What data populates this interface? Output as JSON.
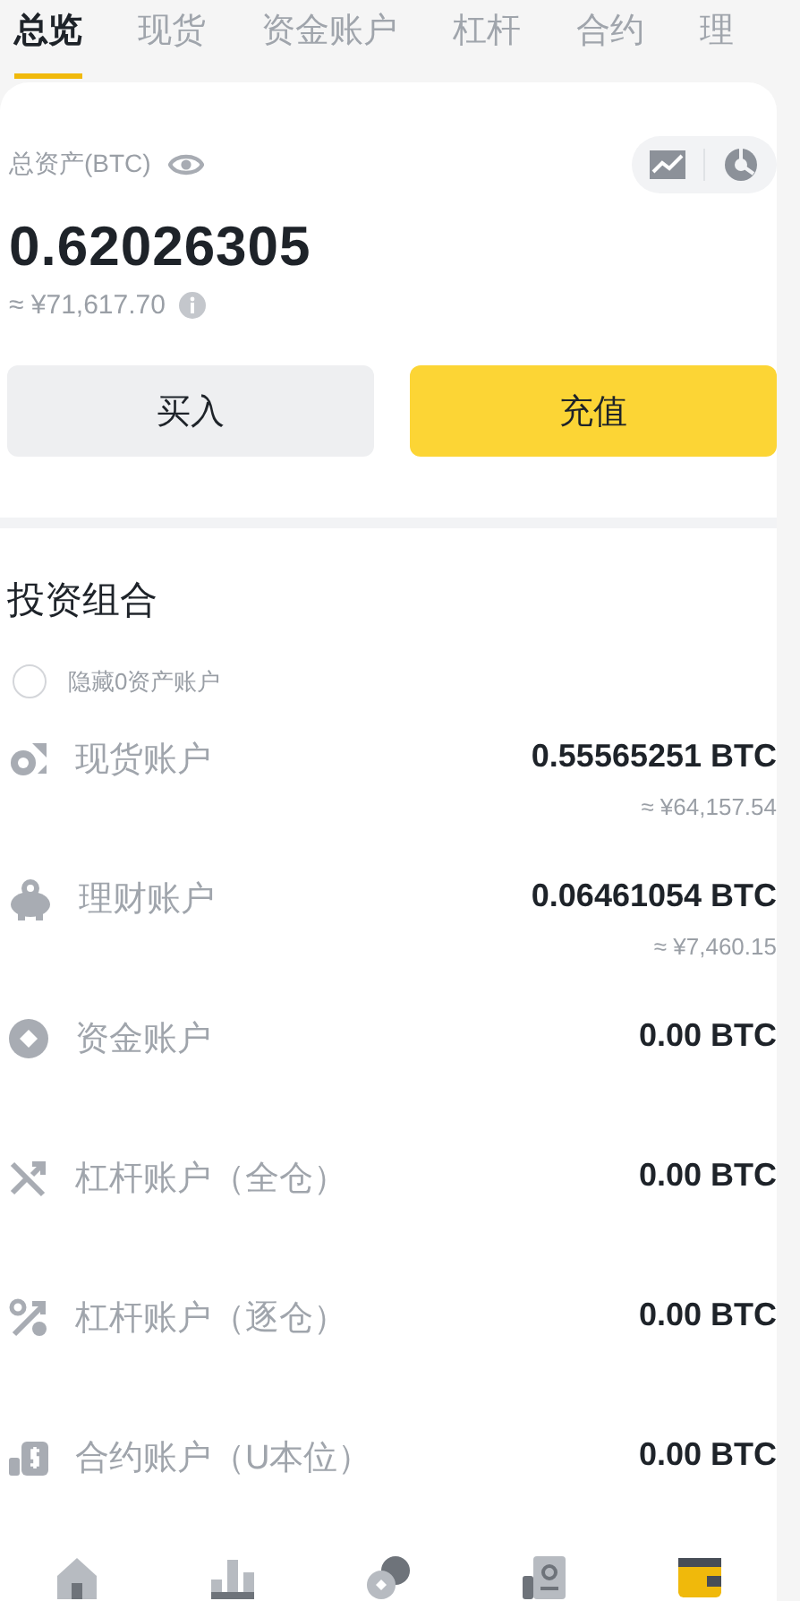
{
  "tabs": [
    {
      "label": "总览",
      "selected": true
    },
    {
      "label": "现货",
      "selected": false
    },
    {
      "label": "资金账户",
      "selected": false
    },
    {
      "label": "杠杆",
      "selected": false
    },
    {
      "label": "合约",
      "selected": false
    },
    {
      "label": "理",
      "selected": false
    }
  ],
  "summary": {
    "label": "总资产(BTC)",
    "total": "0.62026305",
    "fiat": "≈ ¥71,617.70"
  },
  "actions": [
    {
      "label": "买入",
      "kind": "secondary"
    },
    {
      "label": "充值",
      "kind": "primary"
    }
  ],
  "portfolio": {
    "title": "投资组合",
    "hide_zero": {
      "label": "隐藏0资产账户",
      "checked": false
    },
    "accounts": [
      {
        "name": "现货账户",
        "amount": "0.55565251 BTC",
        "fiat": "≈ ¥64,157.54"
      },
      {
        "name": "理财账户",
        "amount": "0.06461054 BTC",
        "fiat": "≈ ¥7,460.15"
      },
      {
        "name": "资金账户",
        "amount": "0.00 BTC"
      },
      {
        "name": "杠杆账户（全仓）",
        "amount": "0.00 BTC"
      },
      {
        "name": "杠杆账户（逐仓）",
        "amount": "0.00 BTC"
      },
      {
        "name": "合约账户（U本位）",
        "amount": "0.00 BTC"
      }
    ]
  },
  "bottom_nav": [
    {
      "selected": false
    },
    {
      "selected": false
    },
    {
      "selected": false
    },
    {
      "selected": false
    },
    {
      "selected": true
    }
  ]
}
